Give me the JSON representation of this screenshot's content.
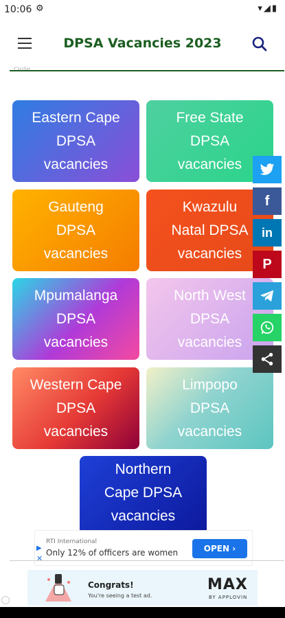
{
  "status_bar": {
    "time": "10:06"
  },
  "header": {
    "title": "DPSA Vacancies 2023",
    "clipped_text": "Orde..."
  },
  "tiles": [
    {
      "label": "Eastern Cape\nDPSA\nvacancies"
    },
    {
      "label": "Free State\nDPSA\nvacancies"
    },
    {
      "label": "Gauteng\nDPSA\nvacancies"
    },
    {
      "label": "Kwazulu\nNatal DPSA\nvacancies"
    },
    {
      "label": "Mpumalanga\nDPSA\nvacancies"
    },
    {
      "label": "North West\nDPSA\nvacancies"
    },
    {
      "label": "Western Cape\nDPSA\nvacancies"
    },
    {
      "label": "Limpopo\nDPSA\nvacancies"
    },
    {
      "label": "Northern\nCape DPSA\nvacancies"
    }
  ],
  "share_buttons": [
    {
      "icon": "twitter-icon",
      "color": "#1da1f2"
    },
    {
      "icon": "facebook-icon",
      "color": "#3b5998"
    },
    {
      "icon": "linkedin-icon",
      "color": "#0077b5"
    },
    {
      "icon": "pinterest-icon",
      "color": "#bd081c"
    },
    {
      "icon": "telegram-icon",
      "color": "#2aa1da"
    },
    {
      "icon": "whatsapp-icon",
      "color": "#25d366"
    },
    {
      "icon": "share-icon",
      "color": "#333333"
    }
  ],
  "inline_ad": {
    "source": "RTI International",
    "text": "Only 12% of officers are women",
    "cta": "OPEN"
  },
  "banner_ad": {
    "headline": "Congrats!",
    "subtext": "You're seeing a test ad.",
    "brand": "MAX",
    "byline": "BY APPLOVIN"
  }
}
